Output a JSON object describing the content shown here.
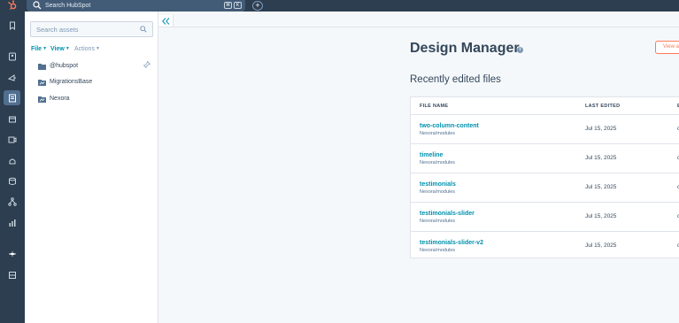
{
  "topbar": {
    "search_placeholder": "Search HubSpot",
    "shortcut_keys": [
      "⌘",
      "K"
    ],
    "add_label": "+"
  },
  "file_panel": {
    "search_placeholder": "Search assets",
    "menu": [
      {
        "label": "File",
        "enabled": true
      },
      {
        "label": "View",
        "enabled": true
      },
      {
        "label": "Actions",
        "enabled": false
      }
    ],
    "tree": [
      {
        "label": "@hubspot",
        "icon": "folder-icon"
      },
      {
        "label": "MigrationsBase",
        "icon": "theme-folder-icon"
      },
      {
        "label": "Nexora",
        "icon": "theme-folder-icon"
      }
    ]
  },
  "main": {
    "title": "Design Manager",
    "info_glyph": "i",
    "view_button_label": "View all",
    "section_title": "Recently edited files",
    "table": {
      "columns": [
        "FILE NAME",
        "LAST EDITED",
        "E"
      ],
      "rows": [
        {
          "name": "two-column-content",
          "path": "Nexora/modules",
          "date": "Jul 15, 2025",
          "extra": "c"
        },
        {
          "name": "timeline",
          "path": "Nexora/modules",
          "date": "Jul 15, 2025",
          "extra": "c"
        },
        {
          "name": "testimonials",
          "path": "Nexora/modules",
          "date": "Jul 15, 2025",
          "extra": "c"
        },
        {
          "name": "testimonials-slider",
          "path": "Nexora/modules",
          "date": "Jul 15, 2025",
          "extra": "c"
        },
        {
          "name": "testimonials-slider-v2",
          "path": "Nexora/modules",
          "date": "Jul 15, 2025",
          "extra": "c"
        }
      ]
    }
  },
  "colors": {
    "nav_dark": "#2d3e50",
    "link": "#0091ae",
    "accent": "#ff7a59",
    "text": "#33475b"
  }
}
